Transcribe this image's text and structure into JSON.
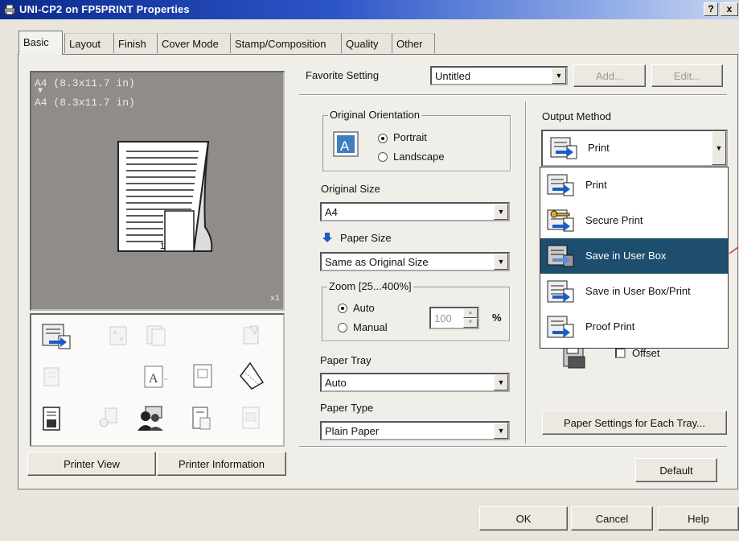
{
  "window": {
    "title": "UNI-CP2 on FP5PRINT Properties",
    "help": "?",
    "close": "x"
  },
  "tabs": [
    {
      "label": "Basic"
    },
    {
      "label": "Layout"
    },
    {
      "label": "Finish"
    },
    {
      "label": "Cover Mode"
    },
    {
      "label": "Stamp/Composition"
    },
    {
      "label": "Quality"
    },
    {
      "label": "Other"
    }
  ],
  "preview": {
    "line1": "A4 (8.3x11.7 in)",
    "arrow": "▼",
    "line2": "A4 (8.3x11.7 in)",
    "page_number": "1",
    "copies": "x1"
  },
  "favorite": {
    "label": "Favorite Setting",
    "value": "Untitled",
    "add": "Add...",
    "edit": "Edit..."
  },
  "orientation": {
    "group": "Original Orientation",
    "portrait": "Portrait",
    "landscape": "Landscape",
    "selected": "Portrait"
  },
  "original_size": {
    "label": "Original Size",
    "value": "A4"
  },
  "paper_size": {
    "label": "Paper Size",
    "value": "Same as Original Size"
  },
  "zoom": {
    "group": "Zoom [25...400%]",
    "auto": "Auto",
    "manual": "Manual",
    "value": "100",
    "unit": "%"
  },
  "paper_tray": {
    "label": "Paper Tray",
    "value": "Auto"
  },
  "paper_type": {
    "label": "Paper Type",
    "value": "Plain Paper"
  },
  "output": {
    "label": "Output Method",
    "value": "Print",
    "options": [
      "Print",
      "Secure Print",
      "Save in User Box",
      "Save in User Box/Print",
      "Proof Print"
    ],
    "selected": "Save in User Box"
  },
  "offset": {
    "label": "Offset",
    "checked": false
  },
  "buttons": {
    "paper_settings": "Paper Settings for Each Tray...",
    "default": "Default",
    "printer_view": "Printer View",
    "printer_info": "Printer Information",
    "ok": "OK",
    "cancel": "Cancel",
    "help": "Help"
  },
  "colors": {
    "title_start": "#0b2a8c",
    "selection": "#1d4e6d",
    "preview_bg": "#8f8c8a"
  }
}
